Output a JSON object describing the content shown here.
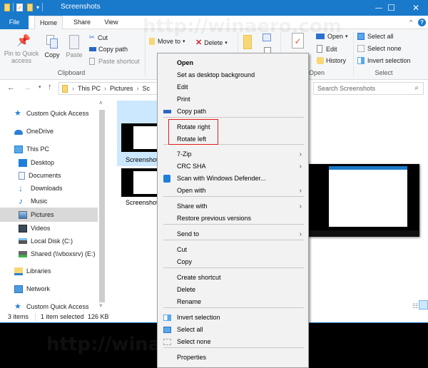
{
  "window": {
    "title": "Screenshots",
    "controls": {
      "minimize": "—",
      "maximize": "☐",
      "close": "✕"
    }
  },
  "ribbon_tabs": [
    {
      "label": "File"
    },
    {
      "label": "Home"
    },
    {
      "label": "Share"
    },
    {
      "label": "View"
    }
  ],
  "ribbon": {
    "clipboard": {
      "label": "Clipboard",
      "pin": "Pin to Quick access",
      "pin_line1": "Pin to Quick",
      "pin_line2": "access",
      "copy": "Copy",
      "paste": "Paste",
      "cut": "Cut",
      "copy_path": "Copy path",
      "paste_shortcut": "Paste shortcut"
    },
    "organize": {
      "move_to": "Move to",
      "delete": "Delete"
    },
    "open": {
      "label": "Open",
      "open": "Open",
      "edit": "Edit",
      "history": "History"
    },
    "select": {
      "label": "Select",
      "select_all": "Select all",
      "select_none": "Select none",
      "invert_selection": "Invert selection"
    }
  },
  "navigation": {
    "breadcrumb": [
      "This PC",
      "Pictures",
      "Sc"
    ],
    "search_placeholder": "Search Screenshots"
  },
  "sidebar": {
    "items": [
      {
        "label": "Custom Quick Access",
        "icon": "star-icon"
      },
      {
        "label": "OneDrive",
        "icon": "cloud-icon"
      },
      {
        "label": "This PC",
        "icon": "computer-icon"
      },
      {
        "label": "Desktop",
        "icon": "desktop-icon"
      },
      {
        "label": "Documents",
        "icon": "documents-icon"
      },
      {
        "label": "Downloads",
        "icon": "download-icon"
      },
      {
        "label": "Music",
        "icon": "music-icon"
      },
      {
        "label": "Pictures",
        "icon": "pictures-icon",
        "selected": true
      },
      {
        "label": "Videos",
        "icon": "videos-icon"
      },
      {
        "label": "Local Disk (C:)",
        "icon": "drive-icon"
      },
      {
        "label": "Shared (\\\\vboxsrv) (E:)",
        "icon": "network-drive-icon"
      },
      {
        "label": "Libraries",
        "icon": "libraries-icon"
      },
      {
        "label": "Network",
        "icon": "network-icon"
      },
      {
        "label": "Custom Quick Access",
        "icon": "star-icon"
      }
    ]
  },
  "files": [
    {
      "name": "Screenshot",
      "selected": true
    },
    {
      "name": "Screenshot",
      "selected": false
    }
  ],
  "status": {
    "items": "3 items",
    "selected": "1 item selected",
    "size": "126 KB"
  },
  "context_menu": {
    "items": [
      {
        "label": "Open",
        "bold": true
      },
      {
        "label": "Set as desktop background"
      },
      {
        "label": "Edit"
      },
      {
        "label": "Print"
      },
      {
        "label": "Copy path",
        "icon": "copy-path-icon"
      },
      {
        "label": "Rotate right",
        "highlighted": true
      },
      {
        "label": "Rotate left",
        "highlighted": true
      },
      {
        "label": "7-Zip",
        "submenu": true
      },
      {
        "label": "CRC SHA",
        "submenu": true
      },
      {
        "label": "Scan with Windows Defender...",
        "icon": "windows-defender-icon"
      },
      {
        "label": "Open with",
        "submenu": true
      },
      {
        "label": "Share with",
        "submenu": true
      },
      {
        "label": "Restore previous versions"
      },
      {
        "label": "Send to",
        "submenu": true
      },
      {
        "label": "Cut"
      },
      {
        "label": "Copy"
      },
      {
        "label": "Create shortcut"
      },
      {
        "label": "Delete"
      },
      {
        "label": "Rename"
      },
      {
        "label": "Invert selection",
        "icon": "invert-selection-icon"
      },
      {
        "label": "Select all",
        "icon": "select-all-icon"
      },
      {
        "label": "Select none",
        "icon": "select-none-icon"
      },
      {
        "label": "Properties"
      }
    ],
    "submenu_arrow": "›"
  },
  "watermark": "http://winaero.com",
  "colors": {
    "accent": "#1979ca",
    "highlight_box": "#e21b1b",
    "selection": "#cce8ff"
  }
}
